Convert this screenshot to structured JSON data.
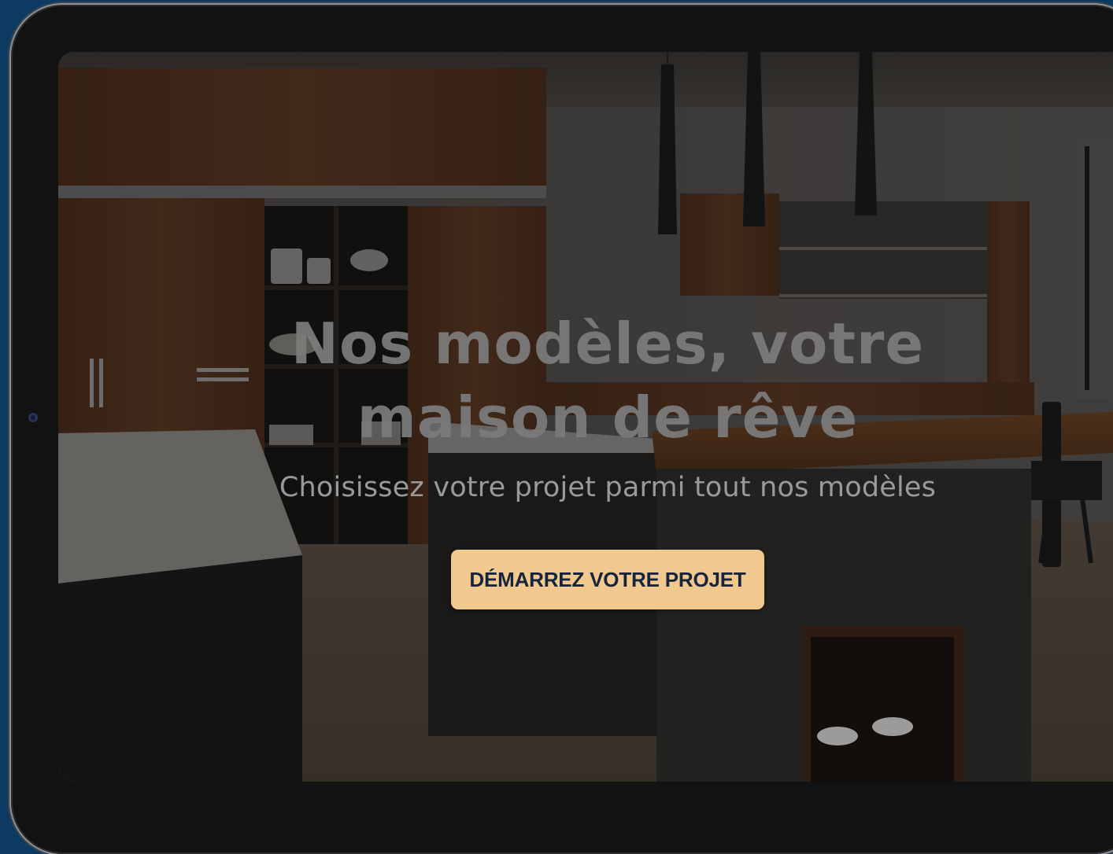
{
  "hero": {
    "title_line1": "Nos modèles, votre",
    "title_line2": "maison de rêve",
    "subtitle": "Choisissez votre projet parmi tout nos modèles",
    "cta_label": "DÉMARREZ VOTRE PROJET"
  },
  "colors": {
    "page_background": "#0d3a62",
    "device_bezel": "#121212",
    "cta_background": "#f1c98e",
    "cta_text": "#17243c"
  },
  "icons": {
    "camera": "front-camera-icon"
  }
}
